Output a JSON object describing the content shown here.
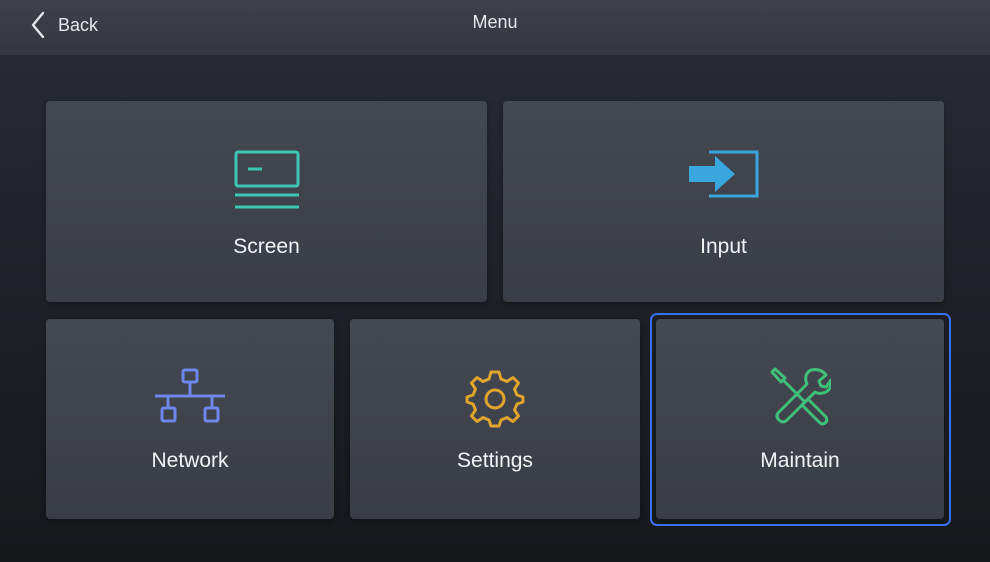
{
  "header": {
    "back_label": "Back",
    "title": "Menu"
  },
  "menu": {
    "items": [
      {
        "id": "screen",
        "label": "Screen",
        "icon": "screen-icon",
        "color": "#3cc7b4"
      },
      {
        "id": "input",
        "label": "Input",
        "icon": "input-icon",
        "color": "#3aa6de"
      },
      {
        "id": "network",
        "label": "Network",
        "icon": "network-icon",
        "color": "#6f86ea"
      },
      {
        "id": "settings",
        "label": "Settings",
        "icon": "gear-icon",
        "color": "#e0a52c"
      },
      {
        "id": "maintain",
        "label": "Maintain",
        "icon": "tools-icon",
        "color": "#3fc07a"
      }
    ],
    "selected": "maintain"
  },
  "colors": {
    "selection": "#3b6ff0",
    "tile": "#41444c",
    "header": "#3a3d44"
  }
}
